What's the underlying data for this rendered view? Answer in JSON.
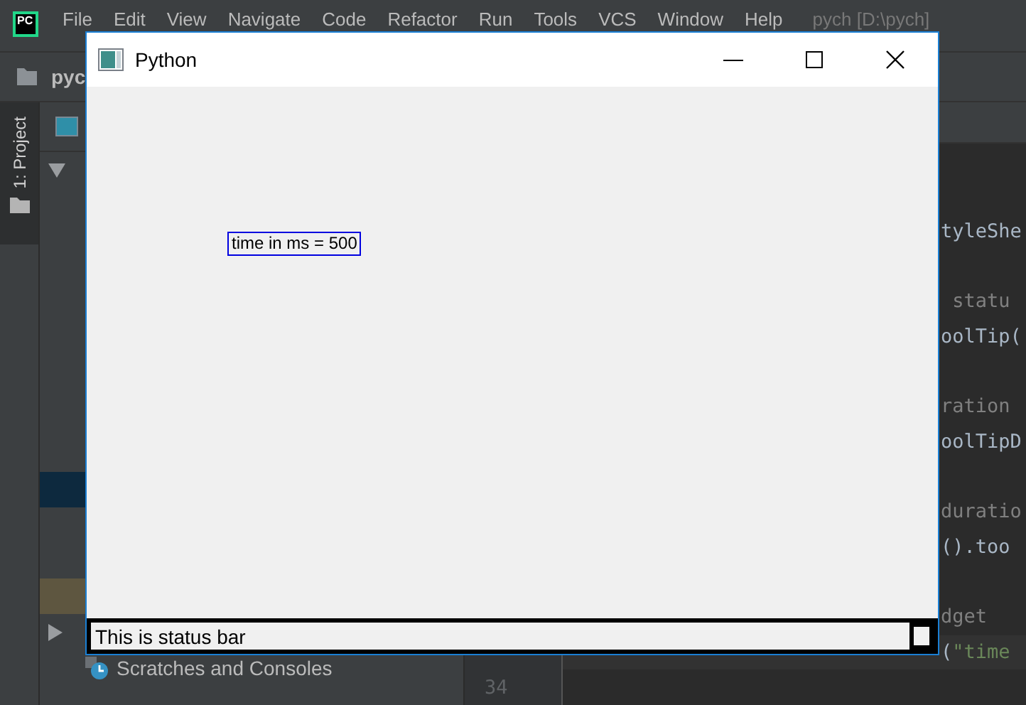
{
  "ide": {
    "logo_text": "PC",
    "menu": [
      "File",
      "Edit",
      "View",
      "Navigate",
      "Code",
      "Refactor",
      "Run",
      "Tools",
      "VCS",
      "Window",
      "Help"
    ],
    "project_title": "pych [D:\\pych]",
    "project_label": "pyc",
    "tool_tab": "1: Project",
    "tree": [
      {
        "expanded": true,
        "selected": false,
        "hovered": false
      },
      {
        "selected": false,
        "hovered": false
      },
      {
        "selected": false,
        "hovered": false
      },
      {
        "selected": false,
        "hovered": false
      },
      {
        "selected": false,
        "hovered": false
      },
      {
        "selected": false,
        "hovered": false
      },
      {
        "selected": false,
        "hovered": false
      },
      {
        "selected": false,
        "hovered": false
      },
      {
        "selected": false,
        "hovered": false
      },
      {
        "selected": true,
        "hovered": false
      },
      {
        "selected": false,
        "hovered": false
      },
      {
        "selected": false,
        "hovered": false
      },
      {
        "selected": false,
        "hovered": true
      },
      {
        "expanded": false,
        "selected": false,
        "hovered": false
      },
      {
        "label": "Scratches and Consoles",
        "selected": false,
        "hovered": false
      }
    ],
    "code_lines": [
      {
        "kind": "blank"
      },
      {
        "kind": "blank"
      },
      {
        "kind": "tail",
        "segments": [
          {
            "kind": "plain",
            "text": "tyleShe"
          }
        ]
      },
      {
        "kind": "blank"
      },
      {
        "kind": "tail",
        "segments": [
          {
            "kind": "comment",
            "text": " statu"
          }
        ]
      },
      {
        "kind": "tail",
        "segments": [
          {
            "kind": "plain",
            "text": "oolTip("
          }
        ]
      },
      {
        "kind": "blank"
      },
      {
        "kind": "tail",
        "segments": [
          {
            "kind": "comment",
            "text": "ration"
          }
        ]
      },
      {
        "kind": "tail",
        "segments": [
          {
            "kind": "plain",
            "text": "oolTipD"
          }
        ]
      },
      {
        "kind": "blank"
      },
      {
        "kind": "tail",
        "segments": [
          {
            "kind": "comment",
            "text": "duratio"
          }
        ]
      },
      {
        "kind": "tail",
        "segments": [
          {
            "kind": "plain",
            "text": "().too"
          }
        ]
      },
      {
        "kind": "blank"
      },
      {
        "kind": "tail",
        "segments": [
          {
            "kind": "comment",
            "text": "dget"
          }
        ]
      },
      {
        "kind": "tail",
        "current": true,
        "segments": [
          {
            "kind": "plain",
            "text": "("
          },
          {
            "kind": "string",
            "text": "\"time"
          }
        ]
      },
      {
        "kind": "blank",
        "number": "34"
      }
    ]
  },
  "window": {
    "title": "Python",
    "label": "time in ms = 500",
    "status_bar": "This is status bar"
  }
}
